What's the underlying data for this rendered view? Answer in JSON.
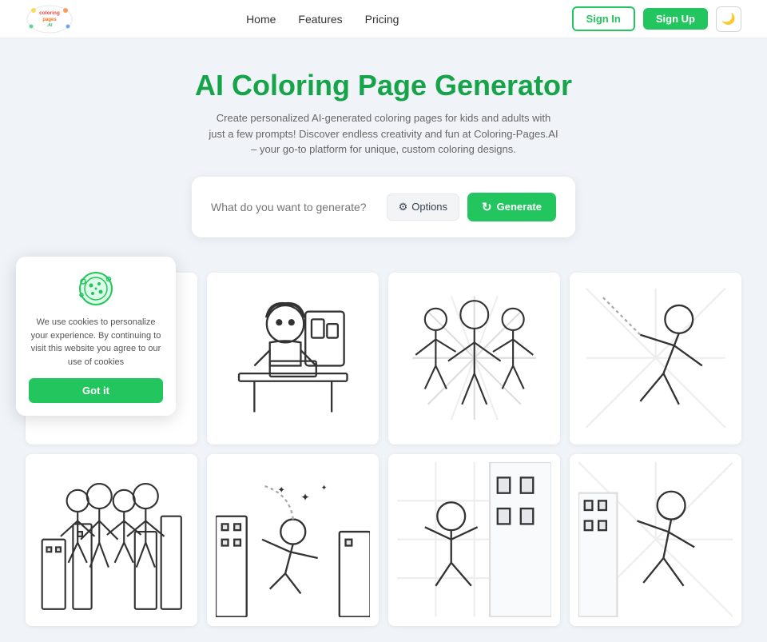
{
  "nav": {
    "links": [
      {
        "label": "Home",
        "href": "#"
      },
      {
        "label": "Features",
        "href": "#"
      },
      {
        "label": "Pricing",
        "href": "#"
      }
    ],
    "signin_label": "Sign In",
    "signup_label": "Sign Up",
    "theme_toggle_icon": "moon"
  },
  "hero": {
    "title": "AI Coloring Page Generator",
    "subtitle": "Create personalized AI-generated coloring pages for kids and adults with just a few prompts! Discover endless creativity and fun at Coloring-Pages.AI – your go-to platform for unique, custom coloring designs."
  },
  "generator": {
    "placeholder": "What do you want to generate?",
    "options_label": "Options",
    "generate_label": "Generate"
  },
  "cookie": {
    "text": "We use cookies to personalize your experience. By continuing to visit this website you agree to our use of cookies",
    "button_label": "Got it"
  }
}
